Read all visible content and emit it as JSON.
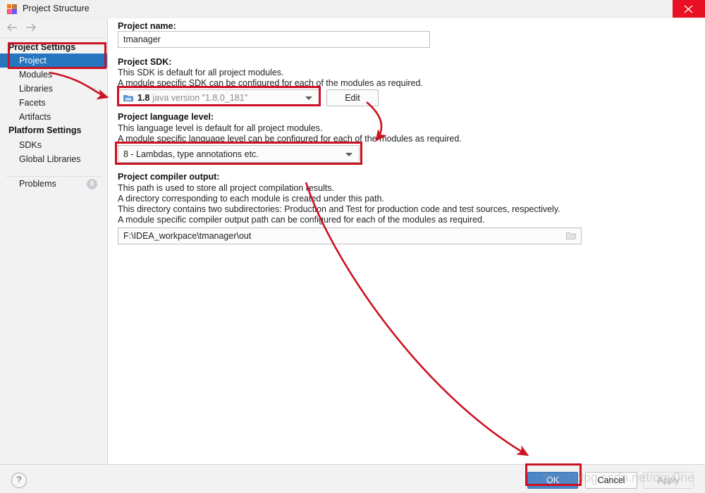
{
  "window": {
    "title": "Project Structure",
    "app_icon": "intellij-idea-icon",
    "close_label": "×"
  },
  "nav": {
    "back_icon": "arrow-left-icon",
    "forward_icon": "arrow-right-icon"
  },
  "sidebar": {
    "sections": [
      {
        "heading": "Project Settings",
        "items": [
          {
            "label": "Project",
            "selected": true
          },
          {
            "label": "Modules",
            "selected": false
          },
          {
            "label": "Libraries",
            "selected": false
          },
          {
            "label": "Facets",
            "selected": false
          },
          {
            "label": "Artifacts",
            "selected": false
          }
        ]
      },
      {
        "heading": "Platform Settings",
        "items": [
          {
            "label": "SDKs",
            "selected": false
          },
          {
            "label": "Global Libraries",
            "selected": false
          }
        ]
      }
    ],
    "problems": {
      "label": "Problems",
      "count": "5"
    }
  },
  "main": {
    "project_name": {
      "label": "Project name:",
      "value": "tmanager"
    },
    "project_sdk": {
      "label": "Project SDK:",
      "desc_line1": "This SDK is default for all project modules.",
      "desc_line2": "A module specific SDK can be configured for each of the modules as required.",
      "sdk_version": "1.8",
      "sdk_description": "java version \"1.8.0_181\"",
      "sdk_icon": "java-sdk-folder-icon",
      "edit_button": "Edit"
    },
    "language_level": {
      "label": "Project language level:",
      "desc_line1": "This language level is default for all project modules.",
      "desc_line2": "A module specific language level can be configured for each of the modules as required.",
      "value": "8 - Lambdas, type annotations etc."
    },
    "compiler_output": {
      "label": "Project compiler output:",
      "desc_line1": "This path is used to store all project compilation results.",
      "desc_line2": "A directory corresponding to each module is created under this path.",
      "desc_line3": "This directory contains two subdirectories: Production and Test for production code and test sources, respectively.",
      "desc_line4": "A module specific compiler output path can be configured for each of the modules as required.",
      "value": "F:\\IDEA_workpace\\tmanager\\out",
      "browse_icon": "folder-browse-icon"
    }
  },
  "footer": {
    "help_label": "?",
    "ok_label": "OK",
    "cancel_label": "Cancel",
    "apply_label": "Apply"
  },
  "watermark": {
    "text": "https://blog.csdn.net/qqy0ne"
  },
  "colors": {
    "accent_blue": "#2675bf",
    "primary_button": "#4a86c8",
    "annotation_red": "#cc1122",
    "close_red": "#e81123"
  }
}
